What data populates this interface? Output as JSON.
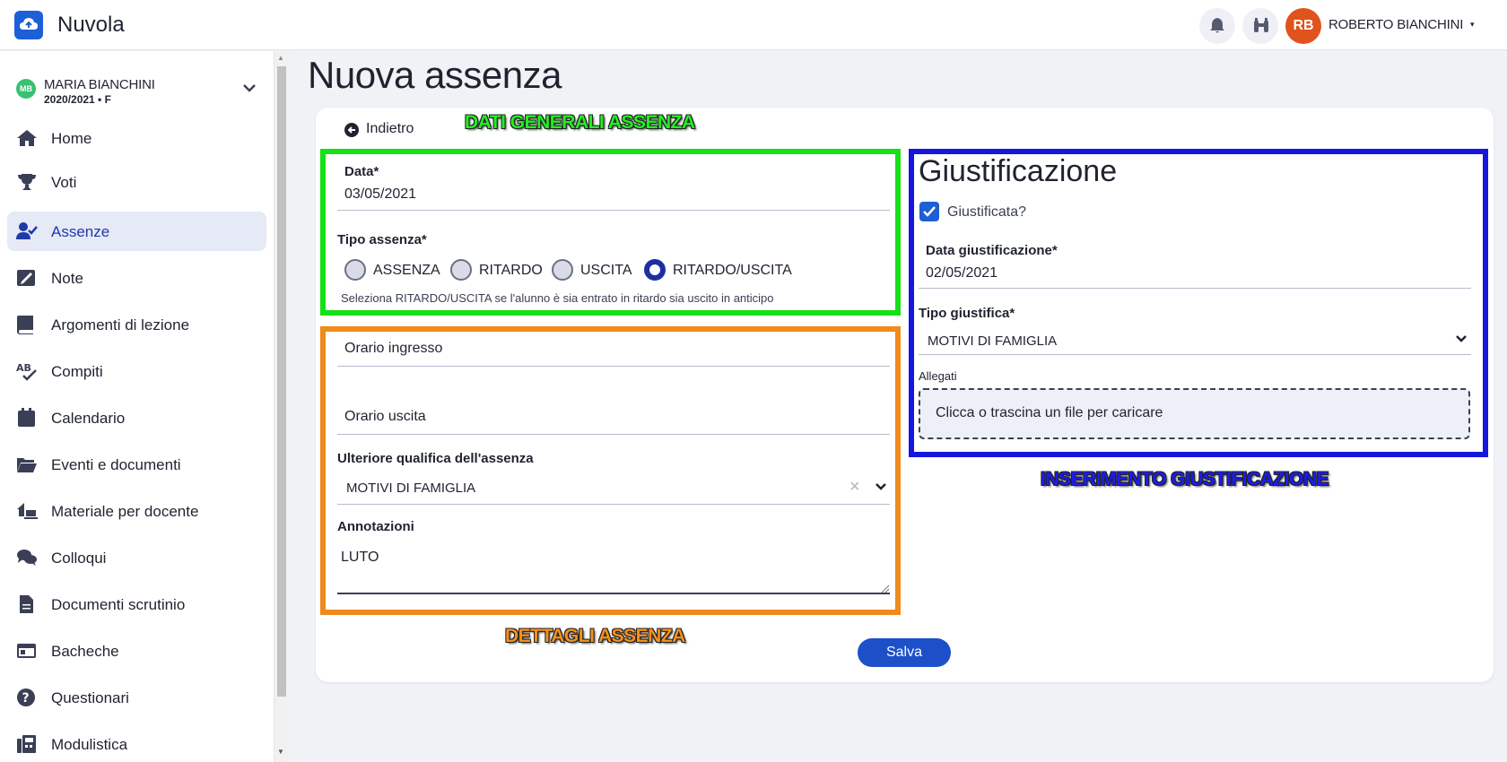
{
  "header": {
    "app_name": "Nuvola",
    "user_initials": "RB",
    "user_name": "ROBERTO BIANCHINI",
    "caret": "▾"
  },
  "student": {
    "initials": "MB",
    "name": "MARIA BIANCHINI",
    "year": "2020/2021 • F"
  },
  "sidebar": {
    "items": [
      {
        "label": "Home",
        "icon": "home-icon"
      },
      {
        "label": "Voti",
        "icon": "trophy-icon"
      },
      {
        "label": "Assenze",
        "icon": "user-check-icon",
        "active": true
      },
      {
        "label": "Note",
        "icon": "note-icon"
      },
      {
        "label": "Argomenti di lezione",
        "icon": "book-icon"
      },
      {
        "label": "Compiti",
        "icon": "spellcheck-icon"
      },
      {
        "label": "Calendario",
        "icon": "calendar-icon"
      },
      {
        "label": "Eventi e documenti",
        "icon": "folder-icon"
      },
      {
        "label": "Materiale per docente",
        "icon": "house-laptop-icon"
      },
      {
        "label": "Colloqui",
        "icon": "comments-icon"
      },
      {
        "label": "Documenti scrutinio",
        "icon": "file-icon"
      },
      {
        "label": "Bacheche",
        "icon": "board-icon"
      },
      {
        "label": "Questionari",
        "icon": "question-icon"
      },
      {
        "label": "Modulistica",
        "icon": "fax-icon"
      }
    ]
  },
  "page": {
    "title": "Nuova assenza",
    "back_label": "Indietro",
    "save_label": "Salva"
  },
  "annotations": {
    "green": "DATI GENERALI ASSENZA",
    "orange": "DETTAGLI ASSENZA",
    "blue": "INSERIMENTO GIUSTIFICAZIONE"
  },
  "general": {
    "date_label": "Data*",
    "date_value": "03/05/2021",
    "type_label": "Tipo assenza*",
    "types": [
      "ASSENZA",
      "RITARDO",
      "USCITA",
      "RITARDO/USCITA"
    ],
    "selected_type": "RITARDO/USCITA",
    "hint": "Seleziona RITARDO/USCITA se l'alunno è sia entrato in ritardo sia uscito in anticipo"
  },
  "details": {
    "entry_placeholder": "Orario ingresso",
    "exit_placeholder": "Orario uscita",
    "qualifier_label": "Ulteriore qualifica dell'assenza",
    "qualifier_value": "MOTIVI DI FAMIGLIA",
    "clear_symbol": "×",
    "notes_label": "Annotazioni",
    "notes_value": "LUTO"
  },
  "justification": {
    "title": "Giustificazione",
    "checkbox_label": "Giustificata?",
    "checked": true,
    "date_label": "Data giustificazione*",
    "date_value": "02/05/2021",
    "type_label": "Tipo giustifica*",
    "type_value": "MOTIVI DI FAMIGLIA",
    "attachments_label": "Allegati",
    "dropzone_text": "Clicca o trascina un file per caricare"
  },
  "colors": {
    "accent": "#1d5fd6",
    "green_box": "#16e016",
    "orange_box": "#f08a1a",
    "blue_box": "#1616e0",
    "user_avatar": "#e0531d",
    "student_avatar": "#38c172"
  }
}
